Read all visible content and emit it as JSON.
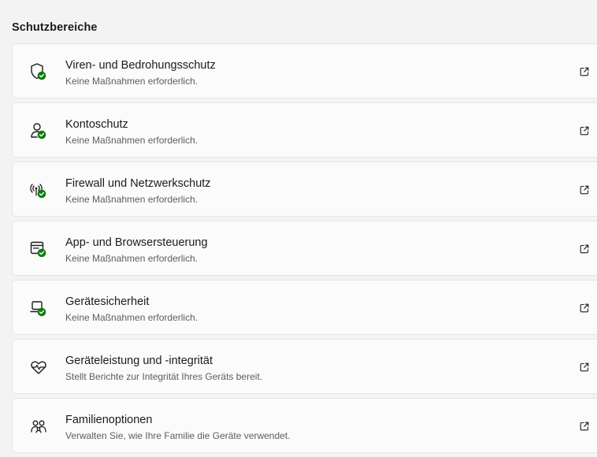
{
  "section": {
    "title": "Schutzbereiche"
  },
  "colors": {
    "status_ok": "#0f7b0f",
    "icon_stroke": "#1b1b1b"
  },
  "items": [
    {
      "title": "Viren- und Bedrohungsschutz",
      "subtitle": "Keine Maßnahmen erforderlich.",
      "icon": "shield-icon",
      "status": "ok"
    },
    {
      "title": "Kontoschutz",
      "subtitle": "Keine Maßnahmen erforderlich.",
      "icon": "account-icon",
      "status": "ok"
    },
    {
      "title": "Firewall und Netzwerkschutz",
      "subtitle": "Keine Maßnahmen erforderlich.",
      "icon": "network-antenna-icon",
      "status": "ok"
    },
    {
      "title": "App- und Browsersteuerung",
      "subtitle": "Keine Maßnahmen erforderlich.",
      "icon": "app-window-icon",
      "status": "ok"
    },
    {
      "title": "Gerätesicherheit",
      "subtitle": "Keine Maßnahmen erforderlich.",
      "icon": "laptop-icon",
      "status": "ok"
    },
    {
      "title": "Geräteleistung und -integrität",
      "subtitle": "Stellt Berichte zur Integrität Ihres Geräts bereit.",
      "icon": "heart-pulse-icon",
      "status": "none"
    },
    {
      "title": "Familienoptionen",
      "subtitle": "Verwalten Sie, wie Ihre Familie die Geräte verwendet.",
      "icon": "family-icon",
      "status": "none"
    }
  ]
}
